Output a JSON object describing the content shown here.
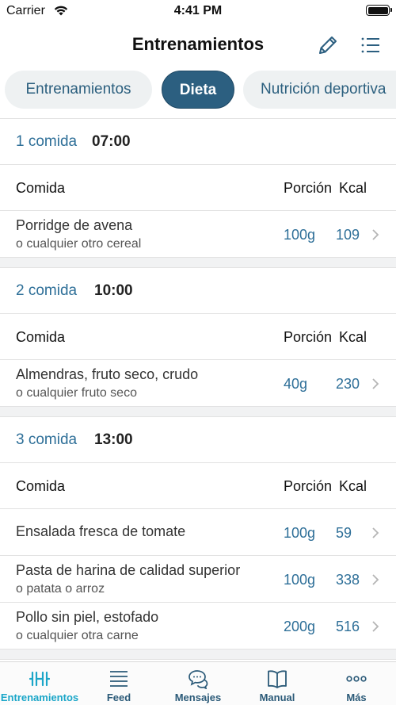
{
  "status": {
    "carrier": "Carrier",
    "time": "4:41 PM"
  },
  "header": {
    "title": "Entrenamientos"
  },
  "tabs": [
    {
      "label": "Entrenamientos",
      "active": false
    },
    {
      "label": "Dieta",
      "active": true
    },
    {
      "label": "Nutrición deportiva",
      "active": false
    }
  ],
  "columns": {
    "food": "Comida",
    "portion": "Porción",
    "kcal": "Kcal"
  },
  "meals": [
    {
      "number": "1 comida",
      "time": "07:00",
      "items": [
        {
          "name": "Porridge de avena",
          "note": "o cualquier otro cereal",
          "portion": "100g",
          "kcal": "109"
        }
      ]
    },
    {
      "number": "2 comida",
      "time": "10:00",
      "items": [
        {
          "name": "Almendras, fruto seco, crudo",
          "note": "o cualquier fruto seco",
          "portion": "40g",
          "kcal": "230"
        }
      ]
    },
    {
      "number": "3 comida",
      "time": "13:00",
      "items": [
        {
          "name": "Ensalada fresca de tomate",
          "note": "",
          "portion": "100g",
          "kcal": "59"
        },
        {
          "name": "Pasta de harina de calidad superior",
          "note": "o patata o arroz",
          "portion": "100g",
          "kcal": "338"
        },
        {
          "name": "Pollo sin piel, estofado",
          "note": "o cualquier otra carne",
          "portion": "200g",
          "kcal": "516"
        }
      ]
    }
  ],
  "tabbar": [
    {
      "label": "Entrenamientos",
      "icon": "dumbbell-icon",
      "active": true
    },
    {
      "label": "Feed",
      "icon": "feed-lines-icon",
      "active": false
    },
    {
      "label": "Mensajes",
      "icon": "chat-bubbles-icon",
      "active": false
    },
    {
      "label": "Manual",
      "icon": "book-icon",
      "active": false
    },
    {
      "label": "Más",
      "icon": "more-dots-icon",
      "active": false
    }
  ],
  "colors": {
    "accent": "#2c5f80",
    "link": "#2e6f98",
    "active_tab": "#1aa6c8"
  }
}
